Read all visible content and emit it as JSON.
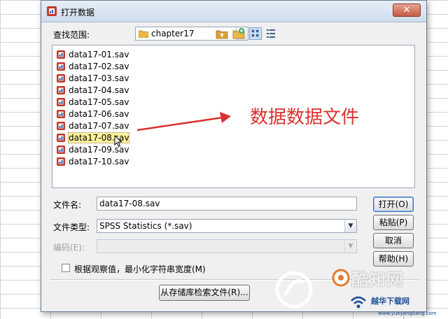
{
  "dialog": {
    "title": "打开数据",
    "close_label": "✕",
    "look_in_label": "查找范围:",
    "look_in_value": "chapter17",
    "files": [
      "data17-01.sav",
      "data17-02.sav",
      "data17-03.sav",
      "data17-04.sav",
      "data17-05.sav",
      "data17-06.sav",
      "data17-07.sav",
      "data17-08.sav",
      "data17-09.sav",
      "data17-10.sav"
    ],
    "selected_file": "data17-08.sav",
    "filename_label": "文件名:",
    "filename_value": "data17-08.sav",
    "filetype_label": "文件类型:",
    "filetype_value": "SPSS Statistics (*.sav)",
    "encoding_label": "编码(E):",
    "encoding_value": "",
    "buttons": {
      "open": "打开(O)",
      "paste": "粘贴(P)",
      "cancel": "取消",
      "help": "帮助(H)"
    },
    "checkbox_label": "根据观察值，最小化字符串宽度(M)",
    "checkbox_checked": false,
    "retrieve_button": "从存储库检索文件(R)..."
  },
  "annotation": {
    "text": "数据数据文件",
    "color": "#d9332f"
  },
  "watermark": {
    "brand": "酷知网",
    "subtitle": "越华下载网",
    "url": "www.yueyangbang.com"
  }
}
